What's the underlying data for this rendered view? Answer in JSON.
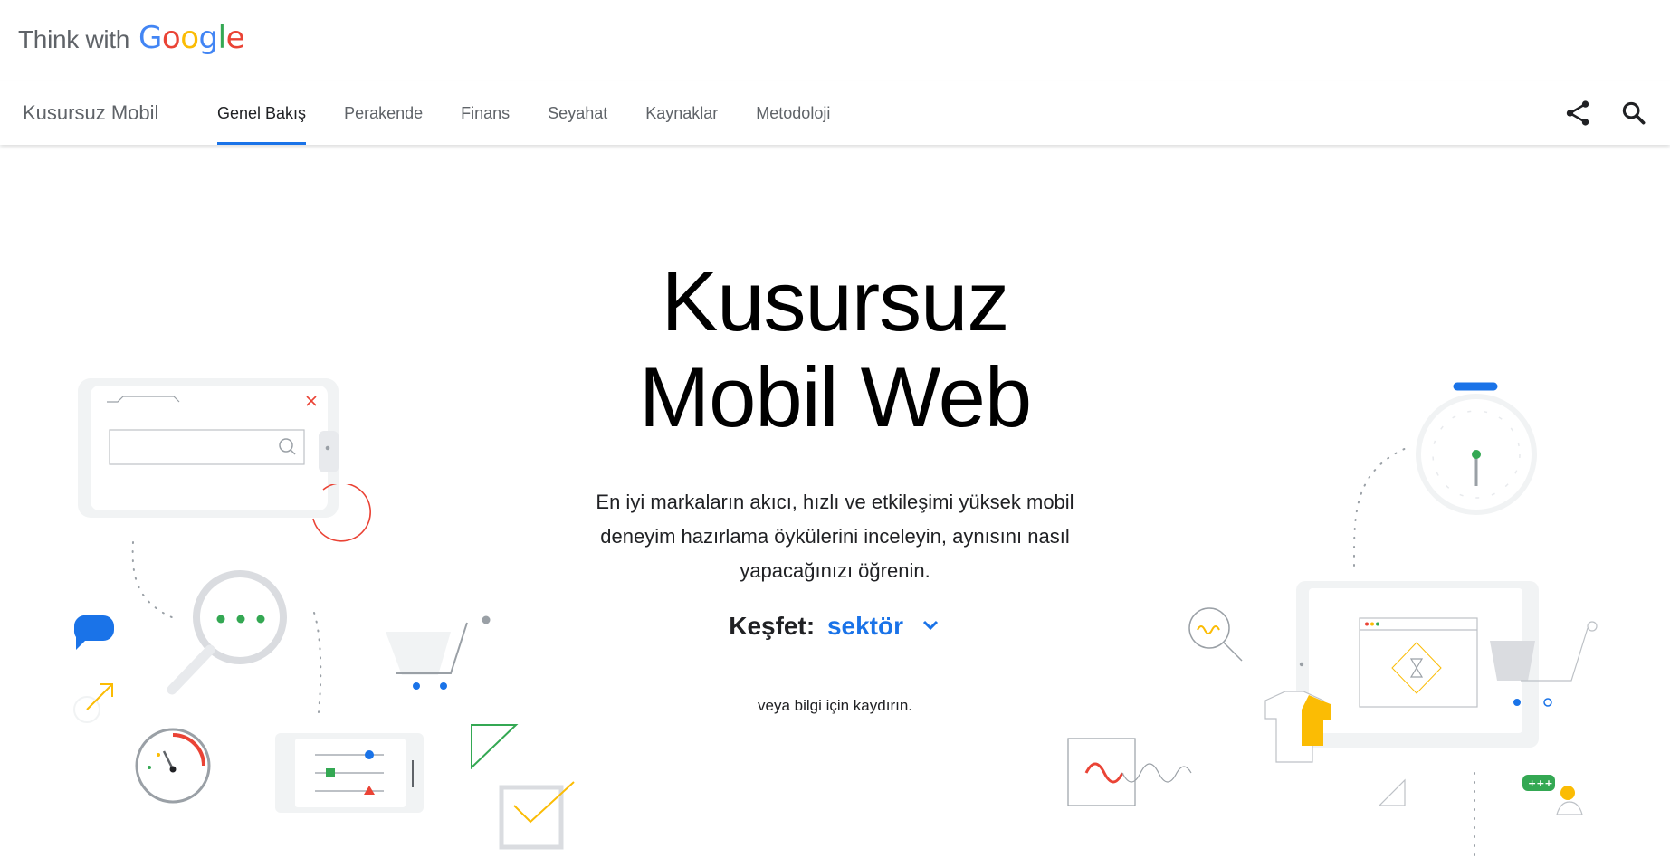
{
  "brand": {
    "think_with": "Think with",
    "google_letters": [
      {
        "char": "G",
        "color": "#4285f4"
      },
      {
        "char": "o",
        "color": "#ea4335"
      },
      {
        "char": "o",
        "color": "#fbbc05"
      },
      {
        "char": "g",
        "color": "#4285f4"
      },
      {
        "char": "l",
        "color": "#34a853"
      },
      {
        "char": "e",
        "color": "#ea4335"
      }
    ]
  },
  "nav": {
    "section_title": "Kusursuz Mobil",
    "tabs": [
      {
        "label": "Genel Bakış",
        "active": true
      },
      {
        "label": "Perakende",
        "active": false
      },
      {
        "label": "Finans",
        "active": false
      },
      {
        "label": "Seyahat",
        "active": false
      },
      {
        "label": "Kaynaklar",
        "active": false
      },
      {
        "label": "Metodoloji",
        "active": false
      }
    ],
    "share_icon": "share-icon",
    "search_icon": "search-icon"
  },
  "hero": {
    "title_line1": "Kusursuz",
    "title_line2": "Mobil Web",
    "description": "En iyi markaların akıcı, hızlı ve etkileşimi yüksek mobil deneyim hazırlama öykülerini inceleyin, aynısını nasıl yapacağınızı öğrenin.",
    "explore_label": "Keşfet:",
    "explore_value": "sektör",
    "scroll_hint": "veya bilgi için kaydırın."
  },
  "colors": {
    "accent": "#1a73e8",
    "green": "#34a853",
    "red": "#ea4335",
    "yellow": "#fbbc04",
    "grey": "#dadce0"
  }
}
